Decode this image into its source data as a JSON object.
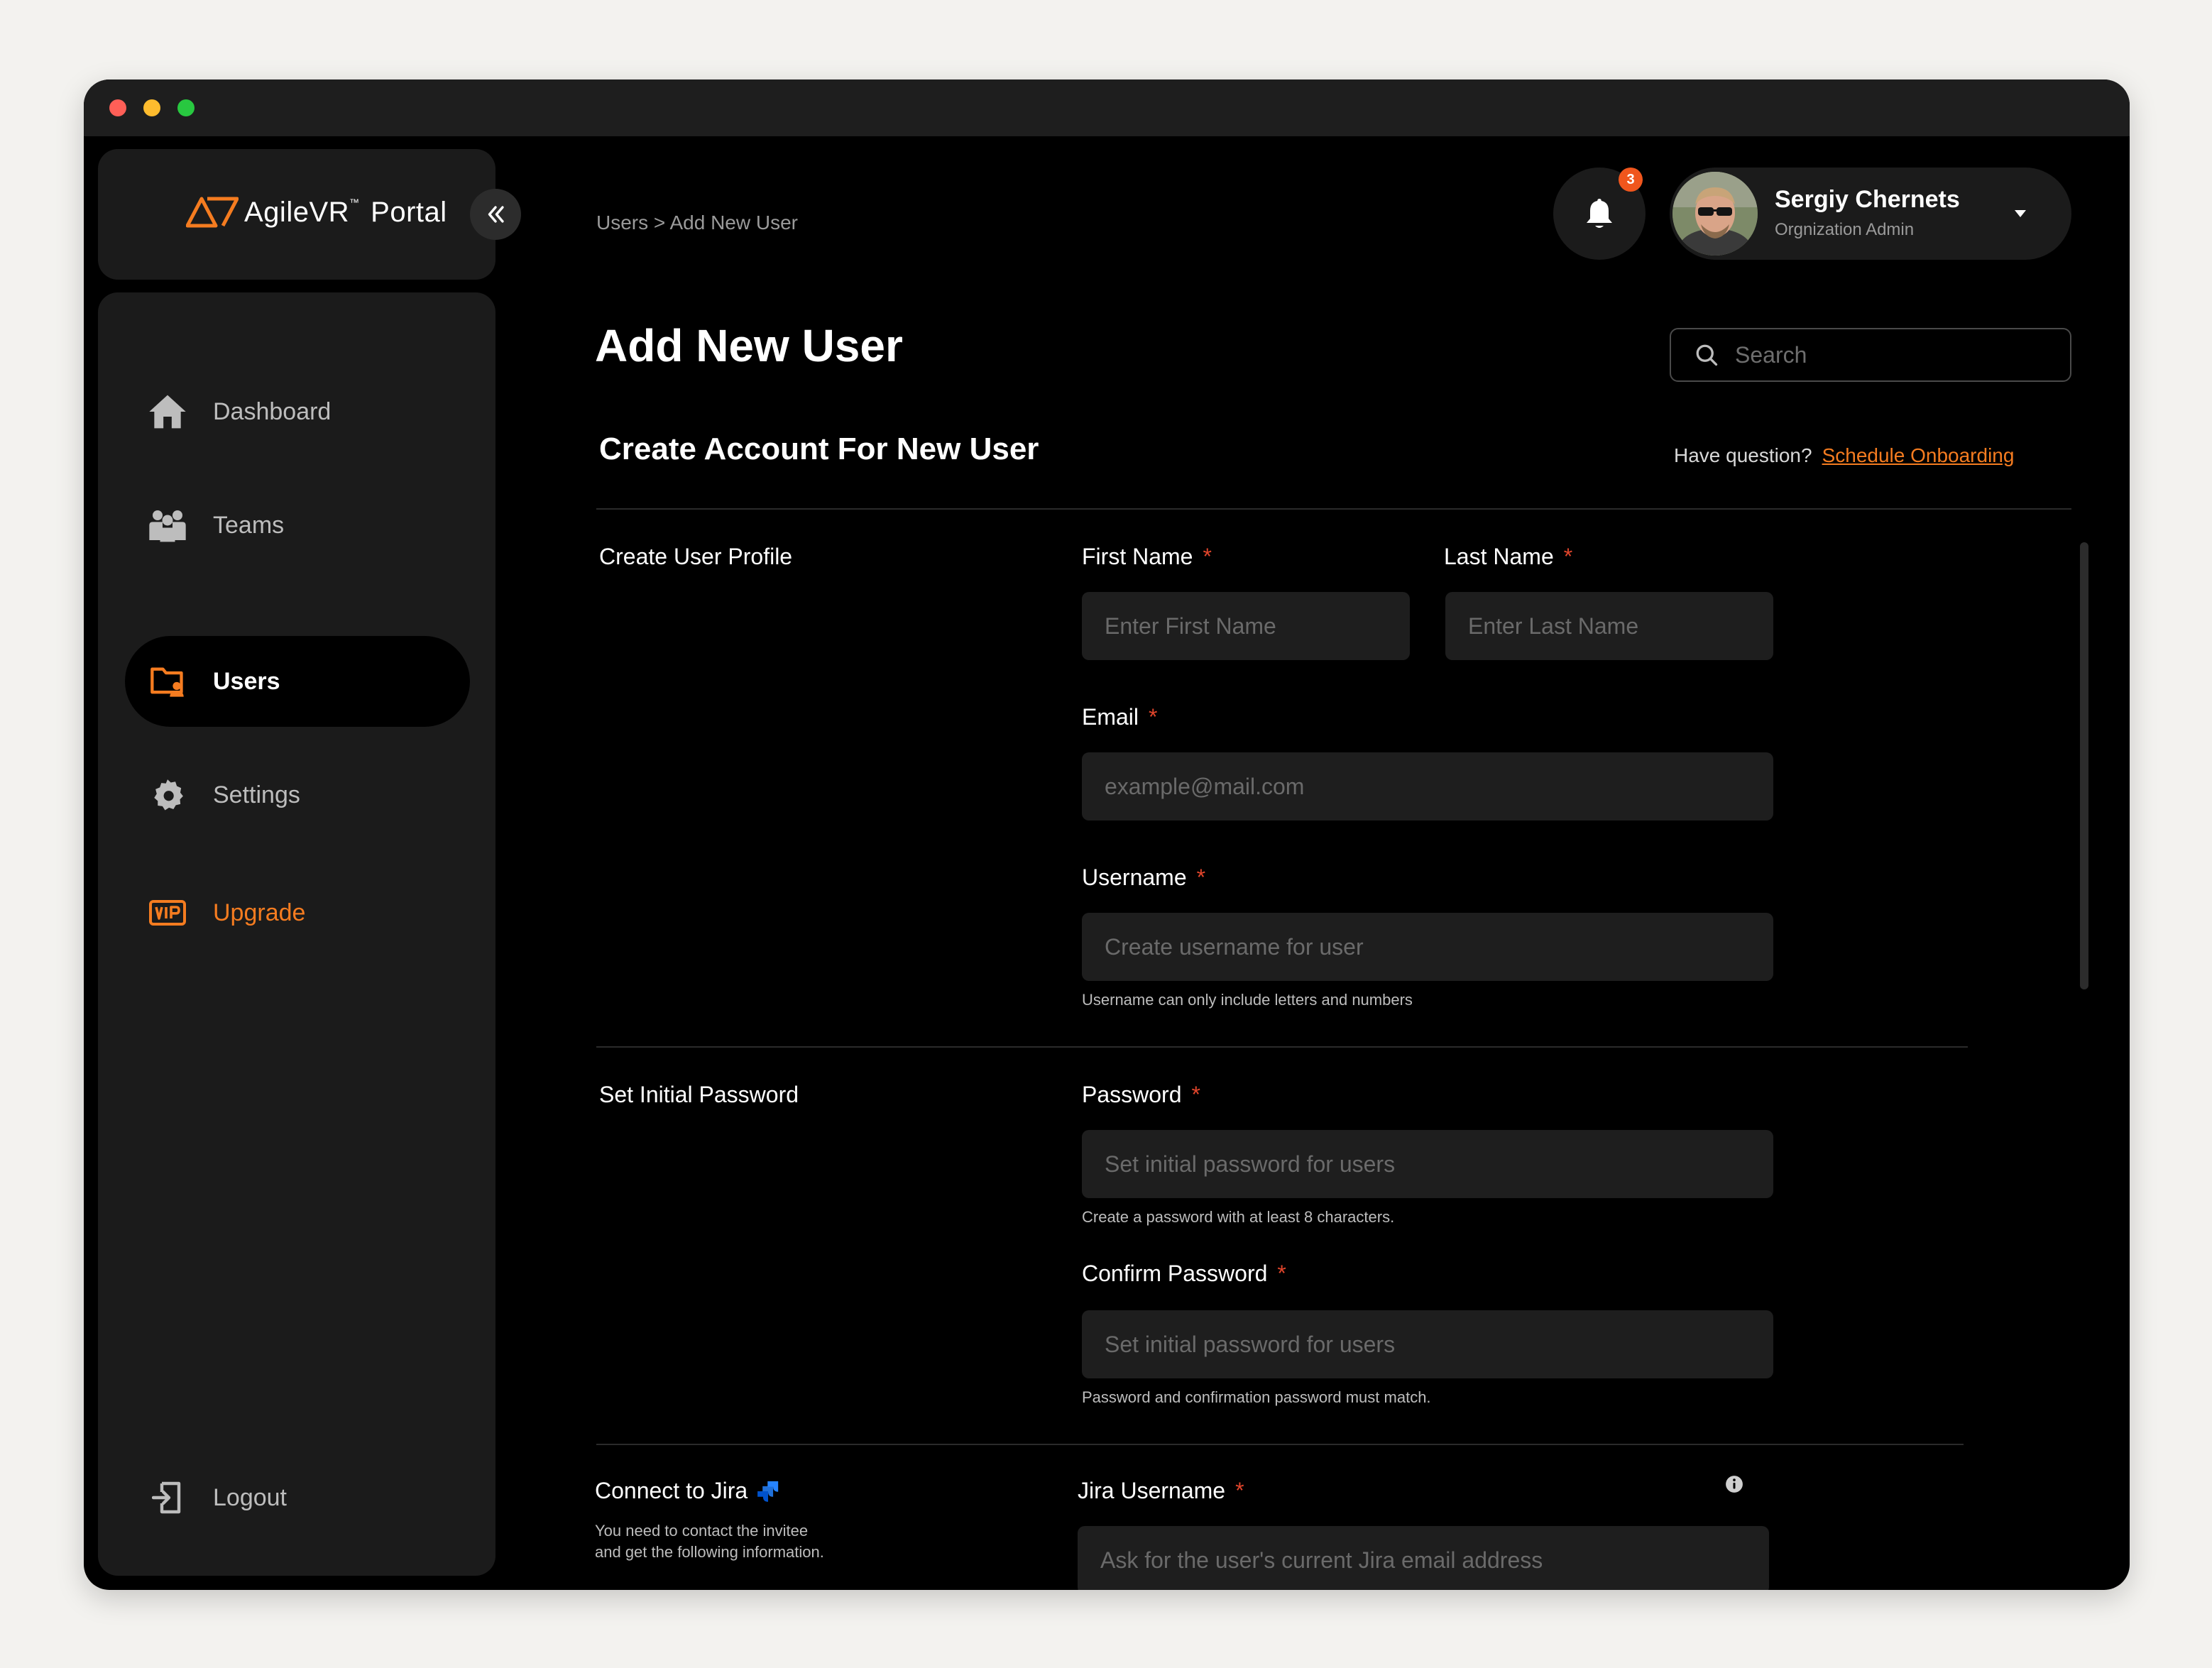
{
  "app": {
    "brand_name": "AgileVR",
    "brand_tm": "™",
    "brand_suffix": "Portal",
    "accent_color": "#f57c20"
  },
  "sidebar": {
    "items": [
      {
        "label": "Dashboard",
        "icon": "home-icon"
      },
      {
        "label": "Teams",
        "icon": "team-icon"
      },
      {
        "label": "Users",
        "icon": "user-folder-icon",
        "active": true
      },
      {
        "label": "Settings",
        "icon": "gear-icon"
      },
      {
        "label": "Upgrade",
        "icon": "vip-icon"
      }
    ],
    "logout_label": "Logout"
  },
  "header": {
    "breadcrumb": "Users > Add New User",
    "notification_count": "3",
    "user_name": "Sergiy Chernets",
    "user_role": "Orgnization Admin",
    "search_placeholder": "Search"
  },
  "page": {
    "title": "Add New User",
    "section_title": "Create Account For New User",
    "question_text": "Have question?",
    "question_link": "Schedule Onboarding"
  },
  "form": {
    "profile": {
      "group_label": "Create User Profile",
      "first_name_label": "First Name",
      "first_name_placeholder": "Enter First Name",
      "last_name_label": "Last Name",
      "last_name_placeholder": "Enter Last Name",
      "email_label": "Email",
      "email_placeholder": "example@mail.com",
      "username_label": "Username",
      "username_placeholder": "Create username for user",
      "username_hint": "Username can only include letters and numbers"
    },
    "password": {
      "group_label": "Set Initial Password",
      "password_label": "Password",
      "password_placeholder": "Set initial password for users",
      "password_hint": "Create a password with at least 8 characters.",
      "confirm_label": "Confirm Password",
      "confirm_placeholder": "Set initial password for users",
      "confirm_hint": "Password and confirmation password must match."
    },
    "jira": {
      "group_label": "Connect to Jira",
      "group_desc_line1": "You need to contact the invitee",
      "group_desc_line2": "and get the following information.",
      "username_label": "Jira Username",
      "username_placeholder": "Ask for the user's current Jira email address"
    },
    "required_mark": "*"
  }
}
